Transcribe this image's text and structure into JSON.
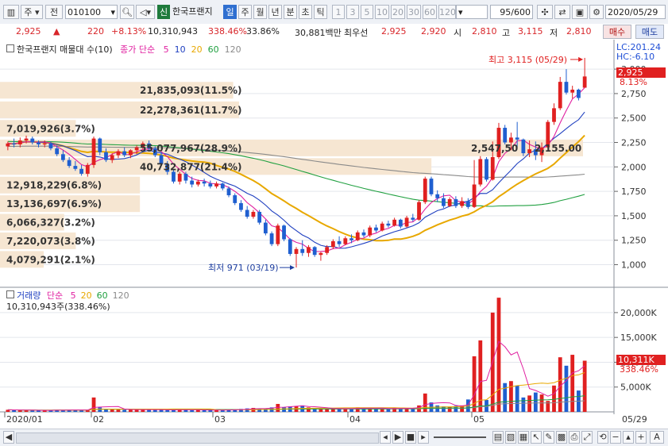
{
  "toolbar": {
    "period_label": "주",
    "prev_label": "전",
    "code_value": "010100",
    "stock_badge": "신",
    "stock_name": "한국프랜지",
    "timeframes": [
      "일",
      "주",
      "월",
      "년",
      "분",
      "초",
      "틱"
    ],
    "selected_timeframe": "일",
    "intervals": [
      "1",
      "3",
      "5",
      "10",
      "20",
      "30",
      "60",
      "120"
    ],
    "count_value": "95",
    "count_total": "/600",
    "date_value": "2020/05/29"
  },
  "quote": {
    "price": "2,925",
    "change_arrow": "▲",
    "change": "220",
    "change_pct": "+8.13%",
    "volume": "10,310,943",
    "volume_pct": "338.46%",
    "turnover_pct": "33.86%",
    "amount": "30,881백만",
    "best_ask_label": "최우선",
    "best_ask": "2,925",
    "best_bid": "2,920",
    "open_label": "시",
    "open": "2,810",
    "high_label": "고",
    "high": "3,115",
    "low_label": "저",
    "low": "2,810",
    "buy_label": "매수",
    "sell_label": "매도"
  },
  "price_legend": {
    "name": "한국프랜지 매물대 수(10)",
    "ma_label": "종가 단순",
    "ma_periods": [
      "5",
      "10",
      "20",
      "60",
      "120"
    ],
    "ma_colors": [
      "#e020a0",
      "#2040c0",
      "#e8a800",
      "#20a040",
      "#8a8a8a"
    ]
  },
  "volume_legend": {
    "name": "거래량",
    "ma_label": "단순",
    "ma_periods": [
      "5",
      "20",
      "60",
      "120"
    ],
    "ma_colors": [
      "#e020a0",
      "#e8a800",
      "#20a040",
      "#8a8a8a"
    ],
    "value_text": "10,310,943주(338.46%)"
  },
  "right_axis": {
    "lc_label": "LC:201.24",
    "hc_label": "HC:-6.10",
    "price_tag": "2,925",
    "pct_tag": "8.13%",
    "vol_tag": "10,311K",
    "vol_pct_tag": "338.46%"
  },
  "annotations": {
    "high_text": "최고 3,115 (05/29)",
    "low_text": "최저 971 (03/19)"
  },
  "colors": {
    "up": "#e02020",
    "down": "#1f5fd0",
    "profile_bar": "#f6e6d2",
    "profile_text": "#333333"
  },
  "chart_data": {
    "type": "candlestick",
    "title": "한국프랜지 매물대 수(10)",
    "price_axis": {
      "ticks": [
        1000,
        1250,
        1500,
        1750,
        2000,
        2250,
        2500,
        2750,
        3000
      ],
      "tick_labels": [
        "1,000",
        "1,250",
        "1,500",
        "1,750",
        "2,000",
        "2,250",
        "2,500",
        "2,750",
        "3,000"
      ],
      "range": [
        850,
        3220
      ]
    },
    "x_ticks": [
      "2020/01",
      "02",
      "03",
      "04",
      "05",
      "05/29"
    ],
    "candles": [
      {
        "o": 2210,
        "h": 2260,
        "l": 2170,
        "c": 2240
      },
      {
        "o": 2240,
        "h": 2290,
        "l": 2200,
        "c": 2230
      },
      {
        "o": 2230,
        "h": 2300,
        "l": 2200,
        "c": 2270
      },
      {
        "o": 2270,
        "h": 2320,
        "l": 2240,
        "c": 2290
      },
      {
        "o": 2290,
        "h": 2310,
        "l": 2230,
        "c": 2250
      },
      {
        "o": 2250,
        "h": 2270,
        "l": 2200,
        "c": 2230
      },
      {
        "o": 2230,
        "h": 2270,
        "l": 2200,
        "c": 2240
      },
      {
        "o": 2240,
        "h": 2260,
        "l": 2170,
        "c": 2190
      },
      {
        "o": 2190,
        "h": 2220,
        "l": 2110,
        "c": 2130
      },
      {
        "o": 2130,
        "h": 2170,
        "l": 2050,
        "c": 2070
      },
      {
        "o": 2070,
        "h": 2100,
        "l": 1990,
        "c": 2010
      },
      {
        "o": 2010,
        "h": 2060,
        "l": 1960,
        "c": 1980
      },
      {
        "o": 1980,
        "h": 2020,
        "l": 1910,
        "c": 1930
      },
      {
        "o": 1930,
        "h": 2040,
        "l": 1900,
        "c": 2020
      },
      {
        "o": 2020,
        "h": 2310,
        "l": 1990,
        "c": 2290
      },
      {
        "o": 2290,
        "h": 2300,
        "l": 2120,
        "c": 2150
      },
      {
        "o": 2150,
        "h": 2190,
        "l": 2050,
        "c": 2070
      },
      {
        "o": 2070,
        "h": 2140,
        "l": 2040,
        "c": 2120
      },
      {
        "o": 2120,
        "h": 2180,
        "l": 2090,
        "c": 2160
      },
      {
        "o": 2160,
        "h": 2200,
        "l": 2100,
        "c": 2120
      },
      {
        "o": 2120,
        "h": 2180,
        "l": 2090,
        "c": 2170
      },
      {
        "o": 2170,
        "h": 2220,
        "l": 2130,
        "c": 2200
      },
      {
        "o": 2200,
        "h": 2260,
        "l": 2180,
        "c": 2240
      },
      {
        "o": 2240,
        "h": 2270,
        "l": 2170,
        "c": 2190
      },
      {
        "o": 2190,
        "h": 2210,
        "l": 2100,
        "c": 2120
      },
      {
        "o": 2120,
        "h": 2150,
        "l": 2010,
        "c": 2030
      },
      {
        "o": 2030,
        "h": 2060,
        "l": 1920,
        "c": 1950
      },
      {
        "o": 1950,
        "h": 1980,
        "l": 1830,
        "c": 1850
      },
      {
        "o": 1850,
        "h": 1950,
        "l": 1820,
        "c": 1930
      },
      {
        "o": 1930,
        "h": 1950,
        "l": 1830,
        "c": 1860
      },
      {
        "o": 1860,
        "h": 1900,
        "l": 1790,
        "c": 1820
      },
      {
        "o": 1820,
        "h": 1870,
        "l": 1800,
        "c": 1850
      },
      {
        "o": 1850,
        "h": 1880,
        "l": 1800,
        "c": 1830
      },
      {
        "o": 1830,
        "h": 1860,
        "l": 1780,
        "c": 1800
      },
      {
        "o": 1800,
        "h": 1850,
        "l": 1780,
        "c": 1830
      },
      {
        "o": 1830,
        "h": 1840,
        "l": 1760,
        "c": 1780
      },
      {
        "o": 1780,
        "h": 1800,
        "l": 1690,
        "c": 1710
      },
      {
        "o": 1710,
        "h": 1730,
        "l": 1610,
        "c": 1630
      },
      {
        "o": 1630,
        "h": 1660,
        "l": 1540,
        "c": 1560
      },
      {
        "o": 1560,
        "h": 1600,
        "l": 1470,
        "c": 1490
      },
      {
        "o": 1490,
        "h": 1560,
        "l": 1470,
        "c": 1540
      },
      {
        "o": 1540,
        "h": 1560,
        "l": 1410,
        "c": 1430
      },
      {
        "o": 1430,
        "h": 1460,
        "l": 1300,
        "c": 1320
      },
      {
        "o": 1320,
        "h": 1340,
        "l": 1190,
        "c": 1210
      },
      {
        "o": 1210,
        "h": 1420,
        "l": 1190,
        "c": 1400
      },
      {
        "o": 1400,
        "h": 1410,
        "l": 1240,
        "c": 1260
      },
      {
        "o": 1260,
        "h": 1270,
        "l": 1090,
        "c": 1110
      },
      {
        "o": 1110,
        "h": 1180,
        "l": 971,
        "c": 1160
      },
      {
        "o": 1160,
        "h": 1250,
        "l": 1090,
        "c": 1120
      },
      {
        "o": 1120,
        "h": 1200,
        "l": 1080,
        "c": 1180
      },
      {
        "o": 1180,
        "h": 1190,
        "l": 1080,
        "c": 1100
      },
      {
        "o": 1100,
        "h": 1130,
        "l": 1040,
        "c": 1120
      },
      {
        "o": 1120,
        "h": 1200,
        "l": 1100,
        "c": 1180
      },
      {
        "o": 1180,
        "h": 1260,
        "l": 1160,
        "c": 1240
      },
      {
        "o": 1240,
        "h": 1290,
        "l": 1180,
        "c": 1210
      },
      {
        "o": 1210,
        "h": 1290,
        "l": 1200,
        "c": 1270
      },
      {
        "o": 1270,
        "h": 1310,
        "l": 1220,
        "c": 1250
      },
      {
        "o": 1250,
        "h": 1350,
        "l": 1240,
        "c": 1330
      },
      {
        "o": 1330,
        "h": 1360,
        "l": 1280,
        "c": 1300
      },
      {
        "o": 1300,
        "h": 1400,
        "l": 1280,
        "c": 1380
      },
      {
        "o": 1380,
        "h": 1410,
        "l": 1330,
        "c": 1350
      },
      {
        "o": 1350,
        "h": 1440,
        "l": 1340,
        "c": 1420
      },
      {
        "o": 1420,
        "h": 1450,
        "l": 1380,
        "c": 1400
      },
      {
        "o": 1400,
        "h": 1480,
        "l": 1390,
        "c": 1460
      },
      {
        "o": 1460,
        "h": 1470,
        "l": 1370,
        "c": 1390
      },
      {
        "o": 1390,
        "h": 1500,
        "l": 1380,
        "c": 1480
      },
      {
        "o": 1480,
        "h": 1520,
        "l": 1440,
        "c": 1460
      },
      {
        "o": 1460,
        "h": 1660,
        "l": 1450,
        "c": 1640
      },
      {
        "o": 1640,
        "h": 1900,
        "l": 1620,
        "c": 1880
      },
      {
        "o": 1880,
        "h": 1900,
        "l": 1700,
        "c": 1720
      },
      {
        "o": 1720,
        "h": 1760,
        "l": 1640,
        "c": 1680
      },
      {
        "o": 1680,
        "h": 1730,
        "l": 1580,
        "c": 1600
      },
      {
        "o": 1600,
        "h": 1690,
        "l": 1590,
        "c": 1670
      },
      {
        "o": 1670,
        "h": 1700,
        "l": 1580,
        "c": 1600
      },
      {
        "o": 1600,
        "h": 1690,
        "l": 1580,
        "c": 1650
      },
      {
        "o": 1650,
        "h": 1680,
        "l": 1570,
        "c": 1590
      },
      {
        "o": 1590,
        "h": 2070,
        "l": 1580,
        "c": 1820
      },
      {
        "o": 1820,
        "h": 2110,
        "l": 1800,
        "c": 2080
      },
      {
        "o": 2080,
        "h": 2100,
        "l": 1850,
        "c": 1870
      },
      {
        "o": 1870,
        "h": 2260,
        "l": 1860,
        "c": 2100
      },
      {
        "o": 2100,
        "h": 2450,
        "l": 2080,
        "c": 2400
      },
      {
        "o": 2400,
        "h": 2430,
        "l": 2230,
        "c": 2250
      },
      {
        "o": 2250,
        "h": 2350,
        "l": 2170,
        "c": 2300
      },
      {
        "o": 2300,
        "h": 2460,
        "l": 2200,
        "c": 2280
      },
      {
        "o": 2280,
        "h": 2290,
        "l": 2110,
        "c": 2140
      },
      {
        "o": 2140,
        "h": 2270,
        "l": 2100,
        "c": 2180
      },
      {
        "o": 2180,
        "h": 2260,
        "l": 2070,
        "c": 2120
      },
      {
        "o": 2120,
        "h": 2250,
        "l": 2050,
        "c": 2200
      },
      {
        "o": 2200,
        "h": 2480,
        "l": 2190,
        "c": 2460
      },
      {
        "o": 2460,
        "h": 2650,
        "l": 2430,
        "c": 2600
      },
      {
        "o": 2600,
        "h": 2920,
        "l": 2580,
        "c": 2870
      },
      {
        "o": 2870,
        "h": 3000,
        "l": 2740,
        "c": 2760
      },
      {
        "o": 2760,
        "h": 2830,
        "l": 2700,
        "c": 2790
      },
      {
        "o": 2790,
        "h": 2800,
        "l": 2680,
        "c": 2705
      },
      {
        "o": 2810,
        "h": 3115,
        "l": 2810,
        "c": 2925
      }
    ],
    "volume_axis": {
      "ticks": [
        5000,
        10000,
        15000,
        20000
      ],
      "tick_labels": [
        "5,000K",
        "10,000K",
        "15,000K",
        "20,000K"
      ],
      "range": [
        0,
        23500
      ],
      "unit": "K"
    },
    "volumes_k": [
      420,
      380,
      350,
      300,
      320,
      280,
      300,
      350,
      400,
      380,
      420,
      360,
      330,
      380,
      2900,
      900,
      600,
      500,
      450,
      420,
      400,
      450,
      500,
      420,
      380,
      400,
      380,
      420,
      500,
      400,
      350,
      380,
      360,
      340,
      380,
      400,
      420,
      500,
      600,
      700,
      800,
      650,
      700,
      900,
      1600,
      900,
      1100,
      1200,
      1300,
      900,
      700,
      650,
      600,
      700,
      650,
      700,
      600,
      900,
      800,
      700,
      650,
      700,
      600,
      800,
      700,
      750,
      800,
      1300,
      3700,
      1900,
      1300,
      1100,
      1000,
      1200,
      1300,
      2500,
      11200,
      14400,
      2400,
      20000,
      23000,
      5800,
      6200,
      5300,
      2900,
      3300,
      3900,
      3500,
      2200,
      5300,
      11000,
      9300,
      11500,
      4300,
      10311
    ],
    "volume_profile": [
      {
        "label": "21,835,093(11.5%)",
        "price": 2780,
        "frac": 0.4
      },
      {
        "label": "22,278,361(11.7%)",
        "price": 2580,
        "frac": 0.41
      },
      {
        "label": "7,019,926(3.7%)",
        "price": 2390,
        "frac": 0.13
      },
      {
        "label": "55,077,967(28.9%)",
        "price": 2190,
        "frac": 1.0
      },
      {
        "label": "40,732,877(21.4%)",
        "price": 2000,
        "frac": 0.74
      },
      {
        "label": "12,918,229(6.8%)",
        "price": 1810,
        "frac": 0.24
      },
      {
        "label": "13,136,697(6.9%)",
        "price": 1620,
        "frac": 0.24
      },
      {
        "label": "6,066,327(3.2%)",
        "price": 1430,
        "frac": 0.11
      },
      {
        "label": "7,220,073(3.8%)",
        "price": 1240,
        "frac": 0.13
      },
      {
        "label": "4,079,291(2.1%)",
        "price": 1050,
        "frac": 0.075
      }
    ],
    "overlay_text": "2,547,50",
    "overlay_text2": "2,155.00"
  }
}
